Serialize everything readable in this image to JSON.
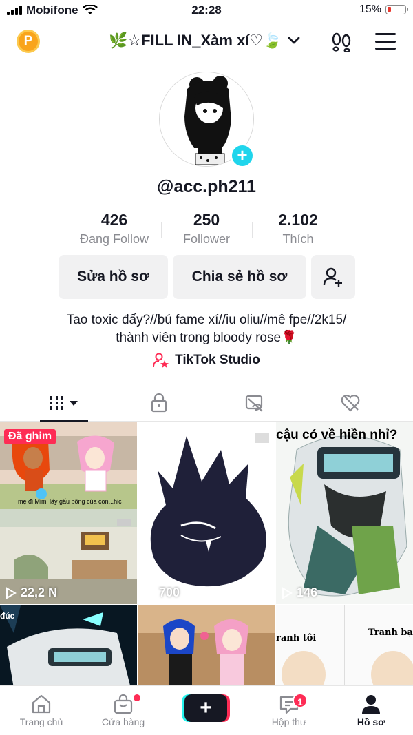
{
  "status_bar": {
    "carrier": "Mobifone",
    "time": "22:28",
    "battery": "15%"
  },
  "header": {
    "coin_letter": "P",
    "title": "🌿☆FILL IN_Xàm xí♡🍃"
  },
  "profile": {
    "username": "@acc.ph211",
    "stats": [
      {
        "value": "426",
        "label": "Đang Follow"
      },
      {
        "value": "250",
        "label": "Follower"
      },
      {
        "value": "2.102",
        "label": "Thích"
      }
    ],
    "edit_button": "Sửa hồ sơ",
    "share_button": "Chia sẻ hồ sơ",
    "bio_line1": "Tao toxic đấy?//bú fame xí//iu oliu//mê fpe//2k15/",
    "bio_line2": "thành viên trong bloody rose🌹",
    "studio_link": "TikTok Studio"
  },
  "videos": [
    {
      "pinned_label": "Đã ghim",
      "views": "22,2 N",
      "caption": "mẹ đi Mimi lấy gấu bông của con...hic"
    },
    {
      "views": "700"
    },
    {
      "views": "146",
      "caption": "cậu có về hiền nhỉ?"
    },
    {
      "caption": "đúc"
    },
    {},
    {
      "caption_left": "ranh tôi",
      "caption_right": "Tranh bạn"
    }
  ],
  "bottom_nav": {
    "home": "Trang chủ",
    "shop": "Cửa hàng",
    "inbox": "Hộp thư",
    "inbox_badge": "1",
    "profile": "Hồ sơ"
  },
  "colors": {
    "accent_red": "#fe2c55",
    "accent_cyan": "#25f4ee",
    "avatar_plus": "#20d5ec",
    "coin": "#f9a41b"
  }
}
